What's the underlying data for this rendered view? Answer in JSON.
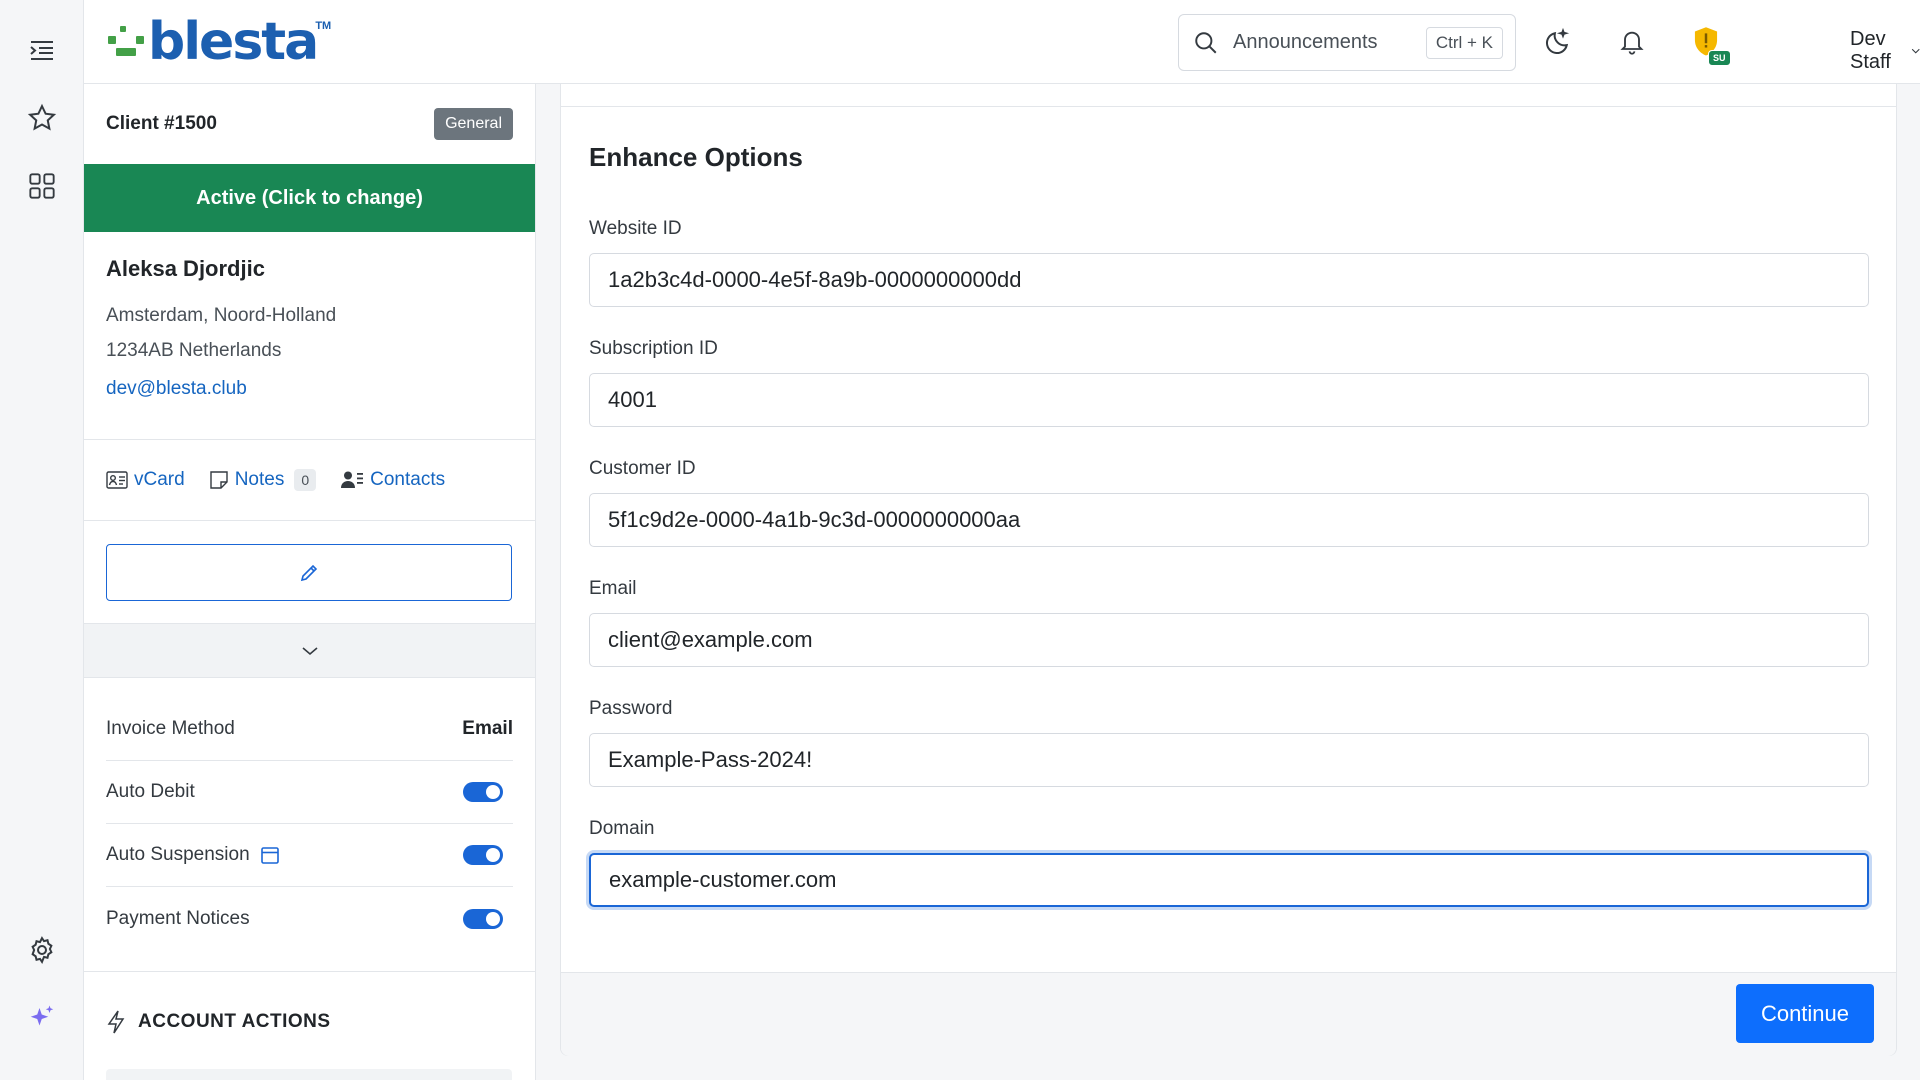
{
  "header": {
    "logo_text": "blesta",
    "logo_tm": "TM",
    "search_placeholder": "Announcements",
    "search_shortcut": "Ctrl + K",
    "su_badge": "SU",
    "user_name": "Dev Staff"
  },
  "client": {
    "number": "Client #1500",
    "group": "General",
    "status": "Active (Click to change)",
    "name": "Aleksa Djordjic",
    "address_line1": "Amsterdam, Noord-Holland",
    "address_line2": "1234AB Netherlands",
    "email": "dev@blesta.club",
    "links": {
      "vcard": "vCard",
      "notes": "Notes",
      "notes_count": "0",
      "contacts": "Contacts"
    },
    "settings": [
      {
        "label": "Invoice Method",
        "value": "Email"
      },
      {
        "label": "Auto Debit",
        "toggle": true
      },
      {
        "label": "Auto Suspension",
        "toggle": true
      },
      {
        "label": "Payment Notices",
        "toggle": true
      }
    ],
    "account_actions": "ACCOUNT ACTIONS"
  },
  "form": {
    "title": "Enhance Options",
    "fields": [
      {
        "label": "Website ID",
        "value": "1a2b3c4d-0000-4e5f-8a9b-0000000000dd"
      },
      {
        "label": "Subscription ID",
        "value": "4001"
      },
      {
        "label": "Customer ID",
        "value": "5f1c9d2e-0000-4a1b-9c3d-0000000000aa"
      },
      {
        "label": "Email",
        "value": "client@example.com"
      },
      {
        "label": "Password",
        "value": "Example-Pass-2024!"
      },
      {
        "label": "Domain",
        "value": "example-customer.com"
      }
    ],
    "continue_label": "Continue"
  },
  "colors": {
    "accent": "#0d6efd",
    "status_green": "#198754",
    "link": "#1565c0",
    "logo_blue": "#1c5fb0",
    "logo_green": "#43a047"
  }
}
